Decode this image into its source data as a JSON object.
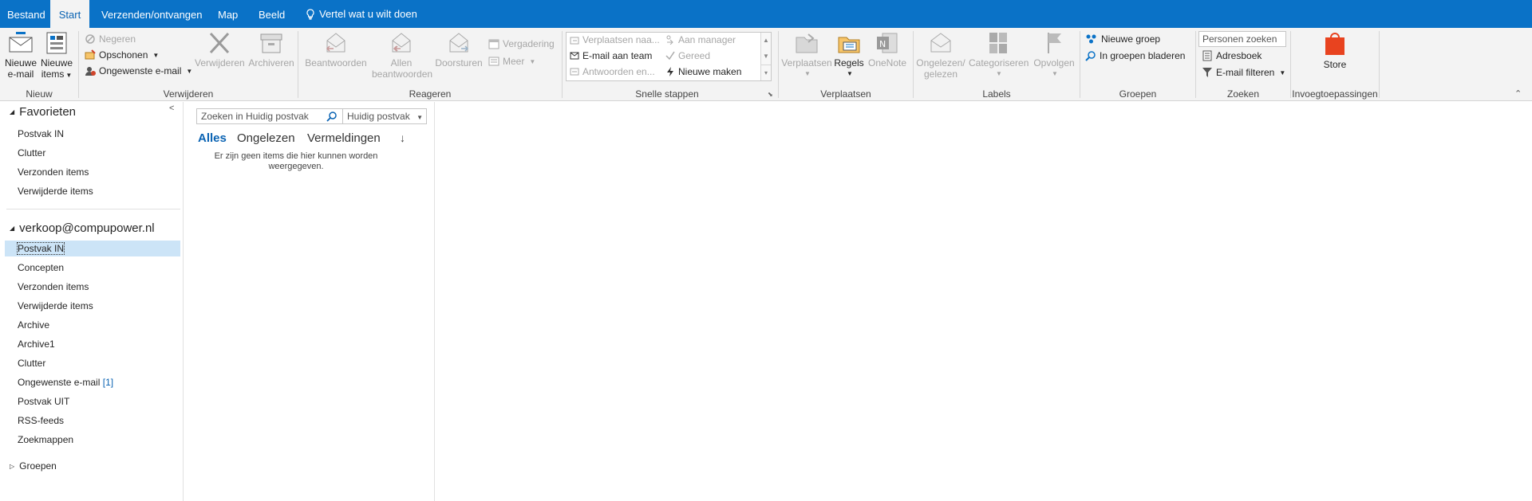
{
  "tabs": [
    "Bestand",
    "Start",
    "Verzenden/ontvangen",
    "Map",
    "Beeld"
  ],
  "tell_me": "Vertel wat u wilt doen",
  "ribbon": {
    "nieuw": {
      "label": "Nieuw",
      "new_email": [
        "Nieuwe",
        "e-mail"
      ],
      "new_items": [
        "Nieuwe",
        "items"
      ]
    },
    "verwijderen": {
      "label": "Verwijderen",
      "ignore": "Negeren",
      "cleanup": "Opschonen",
      "junk": "Ongewenste e-mail",
      "delete": "Verwijderen",
      "archive": "Archiveren"
    },
    "reageren": {
      "label": "Reageren",
      "reply": "Beantwoorden",
      "reply_all": [
        "Allen",
        "beantwoorden"
      ],
      "forward": "Doorsturen",
      "meeting": "Vergadering",
      "more": "Meer"
    },
    "snelle_stappen": {
      "label": "Snelle stappen",
      "items": [
        "Verplaatsen naa...",
        "Aan manager",
        "E-mail aan team",
        "Gereed",
        "Antwoorden en...",
        "Nieuwe maken"
      ]
    },
    "verplaatsen": {
      "label": "Verplaatsen",
      "move": "Verplaatsen",
      "rules": "Regels",
      "onenote": "OneNote"
    },
    "labels": {
      "label": "Labels",
      "unread_read": [
        "Ongelezen/",
        "gelezen"
      ],
      "categorize": "Categoriseren",
      "followup": "Opvolgen"
    },
    "groepen": {
      "label": "Groepen",
      "new_group": "Nieuwe groep",
      "browse_groups": "In groepen bladeren"
    },
    "zoeken": {
      "label": "Zoeken",
      "people_placeholder": "Personen zoeken",
      "address_book": "Adresboek",
      "filter_email": "E-mail filteren"
    },
    "invoeg": {
      "label": "Invoegtoepassingen",
      "store": "Store"
    }
  },
  "nav": {
    "favorites_title": "Favorieten",
    "favorites": [
      "Postvak IN",
      "Clutter",
      "Verzonden items",
      "Verwijderde items"
    ],
    "account": "verkoop@compupower.nl",
    "folders": [
      "Postvak IN",
      "Concepten",
      "Verzonden items",
      "Verwijderde items",
      "Archive",
      "Archive1",
      "Clutter",
      "Ongewenste e-mail",
      "Postvak UIT",
      "RSS-feeds",
      "Zoekmappen"
    ],
    "junk_count": "[1]",
    "groups_title": "Groepen"
  },
  "list": {
    "search_placeholder": "Zoeken in Huidig postvak",
    "scope": "Huidig postvak",
    "filters": [
      "Alles",
      "Ongelezen",
      "Vermeldingen"
    ],
    "empty_message": "Er zijn geen items die hier kunnen worden weergegeven."
  },
  "colors": {
    "accent": "#0a72c7",
    "selected": "#cce4f7",
    "store": "#e8431f"
  }
}
